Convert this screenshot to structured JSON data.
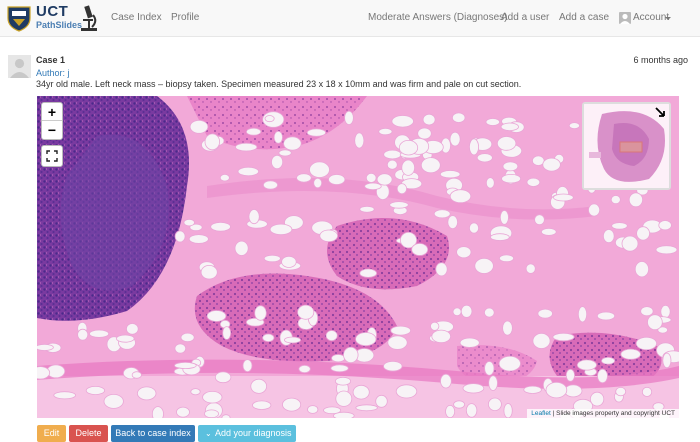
{
  "brand": {
    "line1": "UCT",
    "line2": "PathSlides"
  },
  "nav": {
    "left": [
      "Case Index",
      "Profile"
    ],
    "moderate": "Moderate Answers (Diagnoses)",
    "add_user": "Add a user",
    "add_case": "Add a case",
    "account": "Account"
  },
  "case": {
    "title": "Case 1",
    "time": "6 months ago",
    "author": "Author: j",
    "description": "34yr old male. Left neck mass – biopsy taken. Specimen measured 23 x 18 x 10mm and was firm and pale on cut section."
  },
  "viewer": {
    "zoom_in": "+",
    "zoom_out": "−",
    "attribution_link": "Leaflet",
    "attribution_text": " | Slide images property and copyright UCT"
  },
  "actions": {
    "edit": "Edit",
    "delete": "Delete",
    "back": "Back to case index",
    "diagnosis": "Add your diagnosis"
  },
  "colors": {
    "edit": "#f0ad4e",
    "delete": "#d9534f",
    "back": "#337ab7",
    "diagnosis": "#5bc0de",
    "link": "#337ab7"
  }
}
